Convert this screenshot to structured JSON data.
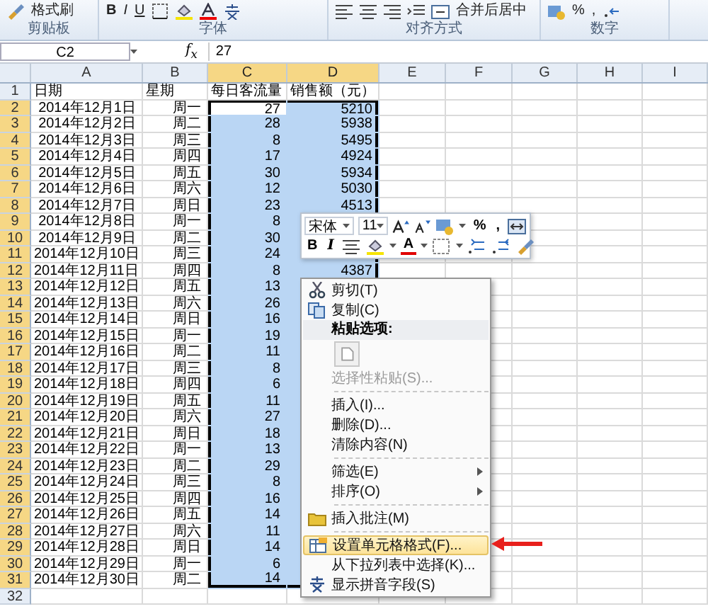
{
  "ribbon": {
    "groups": [
      {
        "label": "剪贴板",
        "buttons": [
          "格式刷"
        ]
      },
      {
        "label": "字体",
        "buttons": [
          "B",
          "I",
          "U"
        ]
      },
      {
        "label": "对齐方式",
        "buttons": [
          "合并后居中"
        ]
      },
      {
        "label": "数字",
        "buttons": [
          "%",
          ","
        ]
      }
    ]
  },
  "formula_bar": {
    "name_box": "C2",
    "fx": "f$_{x}$",
    "value": "27"
  },
  "columns": [
    {
      "label": "A",
      "selected": false
    },
    {
      "label": "B",
      "selected": false
    },
    {
      "label": "C",
      "selected": true
    },
    {
      "label": "D",
      "selected": true
    },
    {
      "label": "E",
      "selected": false
    },
    {
      "label": "F",
      "selected": false
    },
    {
      "label": "G",
      "selected": false
    },
    {
      "label": "H",
      "selected": false
    },
    {
      "label": "I",
      "selected": false
    }
  ],
  "rows": [
    {
      "number": "1",
      "kind": "header",
      "selected": false,
      "cells": [
        "日期",
        "星期",
        "每日客流量",
        "销售额（元）"
      ]
    },
    {
      "number": "2",
      "kind": "data",
      "selected": true,
      "active": true,
      "cells": [
        "2014年12月1日",
        "周一",
        "27",
        "5210"
      ]
    },
    {
      "number": "3",
      "kind": "data",
      "selected": true,
      "cells": [
        "2014年12月2日",
        "周二",
        "28",
        "5938"
      ]
    },
    {
      "number": "4",
      "kind": "data",
      "selected": true,
      "cells": [
        "2014年12月3日",
        "周三",
        "8",
        "5495"
      ]
    },
    {
      "number": "5",
      "kind": "data",
      "selected": true,
      "cells": [
        "2014年12月4日",
        "周四",
        "17",
        "4924"
      ]
    },
    {
      "number": "6",
      "kind": "data",
      "selected": true,
      "cells": [
        "2014年12月5日",
        "周五",
        "30",
        "5934"
      ]
    },
    {
      "number": "7",
      "kind": "data",
      "selected": true,
      "cells": [
        "2014年12月6日",
        "周六",
        "12",
        "5030"
      ]
    },
    {
      "number": "8",
      "kind": "data",
      "selected": true,
      "cells": [
        "2014年12月7日",
        "周日",
        "23",
        "4513"
      ]
    },
    {
      "number": "9",
      "kind": "data",
      "selected": true,
      "cells": [
        "2014年12月8日",
        "周一",
        "8"
      ]
    },
    {
      "number": "10",
      "kind": "data",
      "selected": true,
      "cells": [
        "2014年12月9日",
        "周二",
        "30"
      ]
    },
    {
      "number": "11",
      "kind": "data",
      "selected": true,
      "cells": [
        "2014年12月10日",
        "周三",
        "24"
      ]
    },
    {
      "number": "12",
      "kind": "data",
      "selected": true,
      "cells": [
        "2014年12月11日",
        "周四",
        "8",
        "4387"
      ]
    },
    {
      "number": "13",
      "kind": "data",
      "selected": true,
      "cells": [
        "2014年12月12日",
        "周五",
        "13"
      ]
    },
    {
      "number": "14",
      "kind": "data",
      "selected": true,
      "cells": [
        "2014年12月13日",
        "周六",
        "26"
      ]
    },
    {
      "number": "15",
      "kind": "data",
      "selected": true,
      "cells": [
        "2014年12月14日",
        "周日",
        "16"
      ]
    },
    {
      "number": "16",
      "kind": "data",
      "selected": true,
      "cells": [
        "2014年12月15日",
        "周一",
        "19"
      ]
    },
    {
      "number": "17",
      "kind": "data",
      "selected": true,
      "cells": [
        "2014年12月16日",
        "周二",
        "11"
      ]
    },
    {
      "number": "18",
      "kind": "data",
      "selected": true,
      "cells": [
        "2014年12月17日",
        "周三",
        "8"
      ]
    },
    {
      "number": "19",
      "kind": "data",
      "selected": true,
      "cells": [
        "2014年12月18日",
        "周四",
        "6"
      ]
    },
    {
      "number": "20",
      "kind": "data",
      "selected": true,
      "cells": [
        "2014年12月19日",
        "周五",
        "11"
      ]
    },
    {
      "number": "21",
      "kind": "data",
      "selected": true,
      "cells": [
        "2014年12月20日",
        "周六",
        "27"
      ]
    },
    {
      "number": "22",
      "kind": "data",
      "selected": true,
      "cells": [
        "2014年12月21日",
        "周日",
        "18"
      ]
    },
    {
      "number": "23",
      "kind": "data",
      "selected": true,
      "cells": [
        "2014年12月22日",
        "周一",
        "13"
      ]
    },
    {
      "number": "24",
      "kind": "data",
      "selected": true,
      "cells": [
        "2014年12月23日",
        "周二",
        "29"
      ]
    },
    {
      "number": "25",
      "kind": "data",
      "selected": true,
      "cells": [
        "2014年12月24日",
        "周三",
        "8"
      ]
    },
    {
      "number": "26",
      "kind": "data",
      "selected": true,
      "cells": [
        "2014年12月25日",
        "周四",
        "16"
      ]
    },
    {
      "number": "27",
      "kind": "data",
      "selected": true,
      "cells": [
        "2014年12月26日",
        "周五",
        "14"
      ]
    },
    {
      "number": "28",
      "kind": "data",
      "selected": true,
      "cells": [
        "2014年12月27日",
        "周六",
        "11"
      ]
    },
    {
      "number": "29",
      "kind": "data",
      "selected": true,
      "cells": [
        "2014年12月28日",
        "周日",
        "14"
      ]
    },
    {
      "number": "30",
      "kind": "data",
      "selected": true,
      "cells": [
        "2014年12月29日",
        "周一",
        "6"
      ]
    },
    {
      "number": "31",
      "kind": "data",
      "selected": true,
      "cells": [
        "2014年12月30日",
        "周二",
        "14"
      ]
    },
    {
      "number": "32",
      "kind": "data",
      "selected": false,
      "cells": []
    }
  ],
  "mini_toolbar": {
    "font": "宋体",
    "size": "11",
    "row1_texts": [
      "%",
      ","
    ],
    "row2_texts": [
      "B",
      "I",
      "A"
    ]
  },
  "context_menu": [
    {
      "kind": "command",
      "label": "剪切(T)",
      "disabled": false,
      "selected": false,
      "submenu": false
    },
    {
      "kind": "command",
      "label": "复制(C)",
      "disabled": false,
      "selected": false,
      "submenu": false
    },
    {
      "kind": "header",
      "label": "粘贴选项:"
    },
    {
      "kind": "paste-options"
    },
    {
      "kind": "command",
      "label": "选择性粘贴(S)...",
      "disabled": true,
      "selected": false,
      "submenu": false
    },
    {
      "kind": "separator"
    },
    {
      "kind": "command",
      "label": "插入(I)...",
      "disabled": false,
      "selected": false,
      "submenu": false
    },
    {
      "kind": "command",
      "label": "删除(D)...",
      "disabled": false,
      "selected": false,
      "submenu": false
    },
    {
      "kind": "command",
      "label": "清除内容(N)",
      "disabled": false,
      "selected": false,
      "submenu": false
    },
    {
      "kind": "separator"
    },
    {
      "kind": "command",
      "label": "筛选(E)",
      "disabled": false,
      "selected": false,
      "submenu": true
    },
    {
      "kind": "command",
      "label": "排序(O)",
      "disabled": false,
      "selected": false,
      "submenu": true
    },
    {
      "kind": "separator"
    },
    {
      "kind": "command",
      "label": "插入批注(M)",
      "disabled": false,
      "selected": false,
      "submenu": false
    },
    {
      "kind": "separator"
    },
    {
      "kind": "command",
      "label": "设置单元格格式(F)...",
      "disabled": false,
      "selected": true,
      "submenu": false
    },
    {
      "kind": "command",
      "label": "从下拉列表中选择(K)...",
      "disabled": false,
      "selected": false,
      "submenu": false
    },
    {
      "kind": "command",
      "label": "显示拼音字段(S)",
      "disabled": false,
      "selected": false,
      "submenu": false
    }
  ]
}
